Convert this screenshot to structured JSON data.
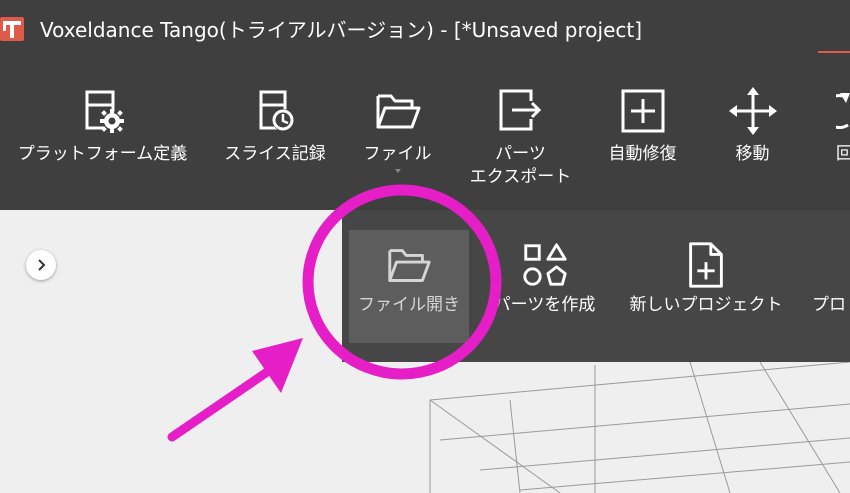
{
  "window": {
    "title": "Voxeldance Tango(トライアルバージョン) - [*Unsaved project]",
    "accent_color": "#e05a4a"
  },
  "toolbar": {
    "items": [
      {
        "id": "platform",
        "label": [
          "プラットフォーム定義"
        ],
        "icon": "platform-settings-icon"
      },
      {
        "id": "slice",
        "label": [
          "スライス記録"
        ],
        "icon": "slice-history-icon"
      },
      {
        "id": "file",
        "label": [
          "ファイル"
        ],
        "icon": "folder-icon",
        "has_menu": true
      },
      {
        "id": "export",
        "label": [
          "パーツ",
          "エクスポート"
        ],
        "icon": "export-icon"
      },
      {
        "id": "repair",
        "label": [
          "自動修復"
        ],
        "icon": "repair-icon"
      },
      {
        "id": "move",
        "label": [
          "移動"
        ],
        "icon": "move-icon"
      },
      {
        "id": "rotate",
        "label": [
          "回"
        ],
        "icon": "rotate-icon"
      }
    ]
  },
  "file_menu": {
    "items": [
      {
        "id": "open",
        "label": "ファイル開き",
        "icon": "folder-open-icon",
        "selected": true
      },
      {
        "id": "create-part",
        "label": "パーツを作成",
        "icon": "shapes-icon"
      },
      {
        "id": "new-project",
        "label": "新しいプロジェクト",
        "icon": "new-file-icon"
      },
      {
        "id": "more",
        "label": "プロ"
      }
    ]
  },
  "annotation": {
    "color": "#e61ec8"
  }
}
